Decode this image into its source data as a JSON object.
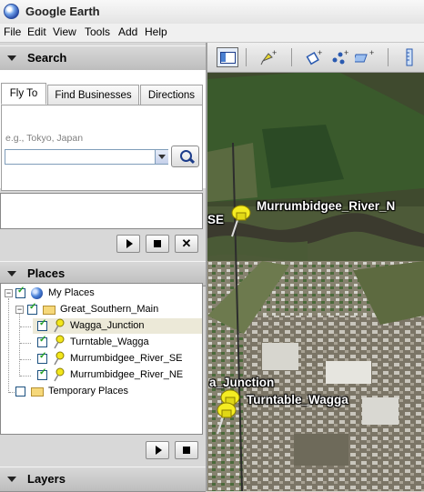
{
  "app": {
    "title": "Google Earth"
  },
  "menu": [
    "File",
    "Edit",
    "View",
    "Tools",
    "Add",
    "Help"
  ],
  "search": {
    "header": "Search",
    "tabs": [
      "Fly To",
      "Find Businesses",
      "Directions"
    ],
    "hint": "e.g., Tokyo, Japan",
    "value": ""
  },
  "places": {
    "header": "Places",
    "tree": {
      "my_places": "My Places",
      "folder": "Great_Southern_Main",
      "items": [
        "Wagga_Junction",
        "Turntable_Wagga",
        "Murrumbidgee_River_SE",
        "Murrumbidgee_River_NE"
      ],
      "temporary": "Temporary Places"
    }
  },
  "layers": {
    "header": "Layers"
  },
  "map": {
    "labels": {
      "river_ne": "Murrumbidgee_River_N",
      "river_se_partial": "SE",
      "junction_partial": "a_Junction",
      "turntable": "Turntable_Wagga"
    }
  },
  "icons": {
    "sidebar_toggle": "sidebar-toggle-icon",
    "tour": "tour-icon",
    "placemark": "add-placemark-icon",
    "polygon": "add-polygon-icon",
    "path": "add-path-icon",
    "ruler": "ruler-icon"
  }
}
